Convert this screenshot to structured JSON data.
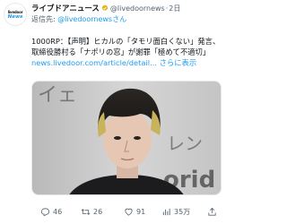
{
  "account": {
    "avatar_line1": "livedoor",
    "avatar_line2": "News",
    "display_name": "ライブドアニュース",
    "handle": "@livedoornews",
    "time": "2日"
  },
  "reply_to": {
    "prefix": "返信先: ",
    "mention": "@livedoornewsさん"
  },
  "body": {
    "line1": "1000RP：【声明】ヒカルの「タモリ面白くない」発言、",
    "line2": "取締役勝村る「ナポリの窓」が謝罪「極めて不適切」",
    "link": "news.livedoor.com/article/detail... さらに表示"
  },
  "media": {
    "sign_text_top": "イェ",
    "sign_text_mid": "レン",
    "sign_text_bottom": "orid"
  },
  "actions": {
    "replies": "46",
    "retweets": "26",
    "likes": "91",
    "views": "35万"
  },
  "colors": {
    "accent": "#1d9bf0",
    "muted": "#536471"
  }
}
